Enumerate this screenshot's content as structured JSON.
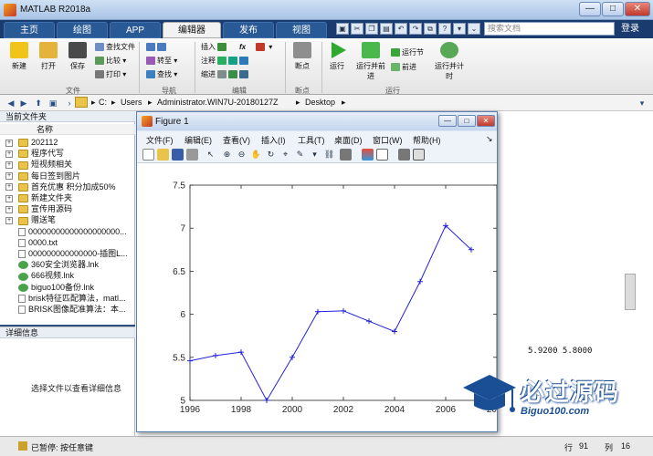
{
  "app": {
    "title": "MATLAB R2018a"
  },
  "tabs": [
    {
      "label": "主页",
      "active": false
    },
    {
      "label": "绘图",
      "active": false
    },
    {
      "label": "APP",
      "active": false
    },
    {
      "label": "编辑器",
      "active": true
    },
    {
      "label": "发布",
      "active": false
    },
    {
      "label": "视图",
      "active": false
    }
  ],
  "search": {
    "placeholder": "搜索文档"
  },
  "login_label": "登录",
  "ribbon": {
    "file": {
      "new": "新建",
      "open": "打开",
      "save": "保存",
      "find_files": "查找文件",
      "compare": "比较",
      "print": "打印",
      "group": "文件"
    },
    "nav": {
      "goto": "转至",
      "find": "查找",
      "group": "导航"
    },
    "edit": {
      "insert": "插入",
      "fx": "fx",
      "comment": "注释",
      "indent": "缩进",
      "group": "编辑"
    },
    "breakpoints": {
      "label": "断点",
      "group": "断点"
    },
    "run": {
      "run": "运行",
      "run_advance": "运行并前进",
      "run_section": "运行节",
      "advance": "前进",
      "run_time": "运行并计时",
      "group": "运行"
    }
  },
  "address": {
    "crumbs": [
      "C:",
      "Users",
      "Administrator.WIN7U-20180127Z",
      "Desktop"
    ]
  },
  "file_panel": {
    "header": "当前文件夹",
    "col_name": "名称",
    "items": [
      {
        "name": "202112",
        "type": "folder",
        "expandable": true
      },
      {
        "name": "程序代写",
        "type": "folder",
        "expandable": true
      },
      {
        "name": "短视频相关",
        "type": "folder",
        "expandable": true
      },
      {
        "name": "每日签到图片",
        "type": "folder",
        "expandable": true
      },
      {
        "name": "首充优惠 积分加成50%",
        "type": "folder",
        "expandable": true
      },
      {
        "name": "新建文件夹",
        "type": "folder",
        "expandable": true
      },
      {
        "name": "宣传用源码",
        "type": "folder",
        "expandable": true
      },
      {
        "name": "赠送笔",
        "type": "folder",
        "expandable": true
      },
      {
        "name": "00000000000000000000...",
        "type": "doc",
        "expandable": false
      },
      {
        "name": "0000.txt",
        "type": "doc",
        "expandable": false
      },
      {
        "name": "000000000000000-插图L...",
        "type": "doc",
        "expandable": false
      },
      {
        "name": "360安全浏览器.lnk",
        "type": "lnk",
        "expandable": false
      },
      {
        "name": "666视频.lnk",
        "type": "lnk",
        "expandable": false
      },
      {
        "name": "biguo100备份.lnk",
        "type": "lnk",
        "expandable": false
      },
      {
        "name": "brisk特征匹配算法，matl...",
        "type": "doc",
        "expandable": false
      },
      {
        "name": "BRISK图像配准算法：本...",
        "type": "doc",
        "expandable": false
      }
    ]
  },
  "detail_panel": {
    "header": "详细信息",
    "text": "选择文件以查看详细信息"
  },
  "workspace_values": "5.9200    5.8000",
  "status": {
    "left": "已暂停: 按任意键",
    "row_label": "行",
    "row_value": "91",
    "col_label": "列",
    "col_value": "16"
  },
  "figure": {
    "title": "Figure 1",
    "menu": [
      "文件(F)",
      "编辑(E)",
      "查看(V)",
      "插入(I)",
      "工具(T)",
      "桌面(D)",
      "窗口(W)",
      "帮助(H)"
    ]
  },
  "chart_data": {
    "type": "line",
    "x": [
      1996,
      1997,
      1998,
      1999,
      2000,
      2001,
      2002,
      2003,
      2004,
      2005,
      2006,
      2007
    ],
    "series": [
      {
        "values": [
          5.46,
          5.52,
          5.56,
          5.0,
          5.5,
          6.03,
          6.04,
          5.92,
          5.8,
          6.38,
          7.03,
          6.75
        ],
        "color": "#2222dd",
        "marker": "+"
      }
    ],
    "xlim": [
      1996,
      2008
    ],
    "ylim": [
      5,
      7.5
    ],
    "xticks": [
      "1996",
      "1998",
      "2000",
      "2002",
      "2004",
      "2006",
      "2008"
    ],
    "yticks": [
      "5",
      "5.5",
      "6",
      "6.5",
      "7",
      "7.5"
    ],
    "grid": false
  },
  "watermark": {
    "title": "必过源码",
    "subtitle": "Biguo100.com"
  }
}
